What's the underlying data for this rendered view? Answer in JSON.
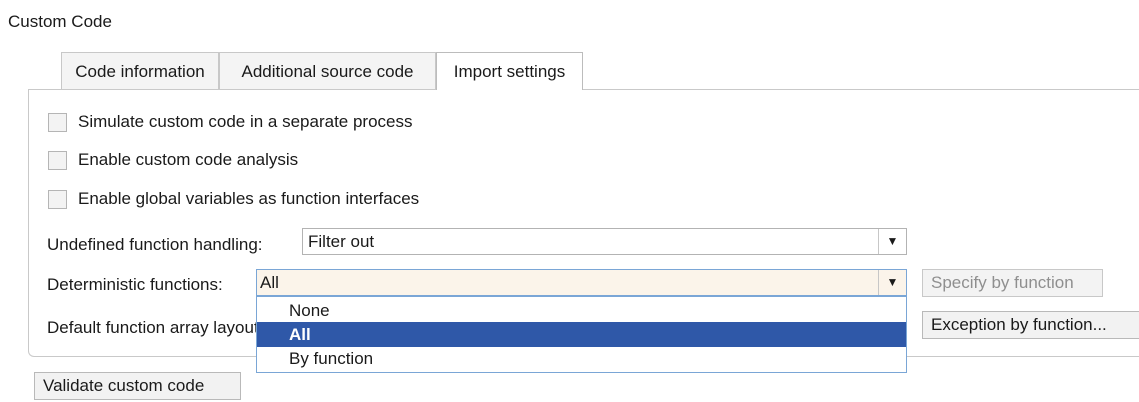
{
  "section": {
    "title": "Custom Code"
  },
  "tabs": [
    {
      "label": "Code information"
    },
    {
      "label": "Additional source code"
    },
    {
      "label": "Import settings"
    }
  ],
  "checkboxes": [
    {
      "label": "Simulate custom code in a separate process",
      "checked": false
    },
    {
      "label": "Enable custom code analysis",
      "checked": false
    },
    {
      "label": "Enable global variables as function interfaces",
      "checked": false
    }
  ],
  "undefined_handling": {
    "label": "Undefined function handling:",
    "value": "Filter out"
  },
  "deterministic": {
    "label": "Deterministic functions:",
    "value": "All",
    "specify_button": "Specify by function"
  },
  "array_layout": {
    "label": "Default function array layout:",
    "exception_button": "Exception by function..."
  },
  "dropdown": {
    "options": [
      "None",
      "All",
      "By function"
    ],
    "selected": "All"
  },
  "validate_button": "Validate custom code",
  "icons": {
    "combo_arrow": "▼"
  }
}
